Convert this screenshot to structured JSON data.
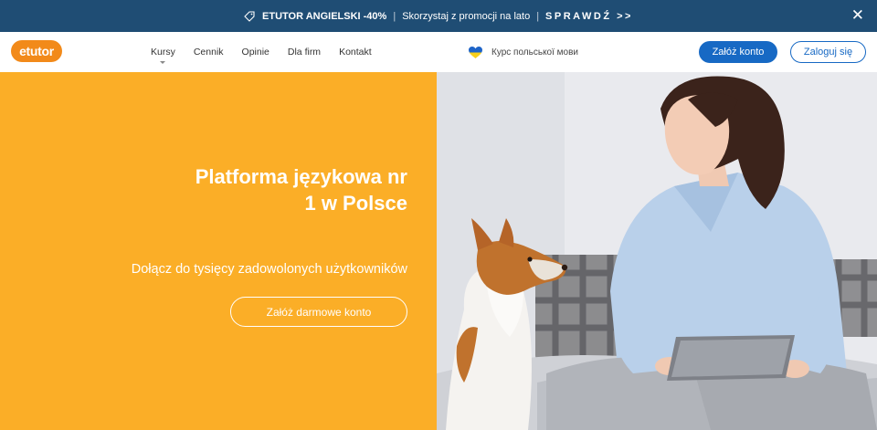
{
  "promo": {
    "title": "ETUTOR ANGIELSKI -40%",
    "text": "Skorzystaj z promocji na lato",
    "cta": "SPRAWDŹ >>",
    "close": "✕"
  },
  "nav": {
    "logo": "etutor",
    "items": [
      "Kursy",
      "Cennik",
      "Opinie",
      "Dla firm",
      "Kontakt"
    ],
    "ua_link": "Курс польської мови",
    "register": "Załóż konto",
    "login": "Zaloguj się"
  },
  "hero": {
    "title": "Platforma językowa nr 1 w Polsce",
    "subtitle": "Dołącz do tysięcy zadowolonych użytkowników",
    "button": "Załóż darmowe konto"
  },
  "colors": {
    "promo_bg": "#1f4d74",
    "brand_orange": "#f28a1a",
    "hero_yellow": "#fbae27",
    "primary_blue": "#1769c4"
  }
}
